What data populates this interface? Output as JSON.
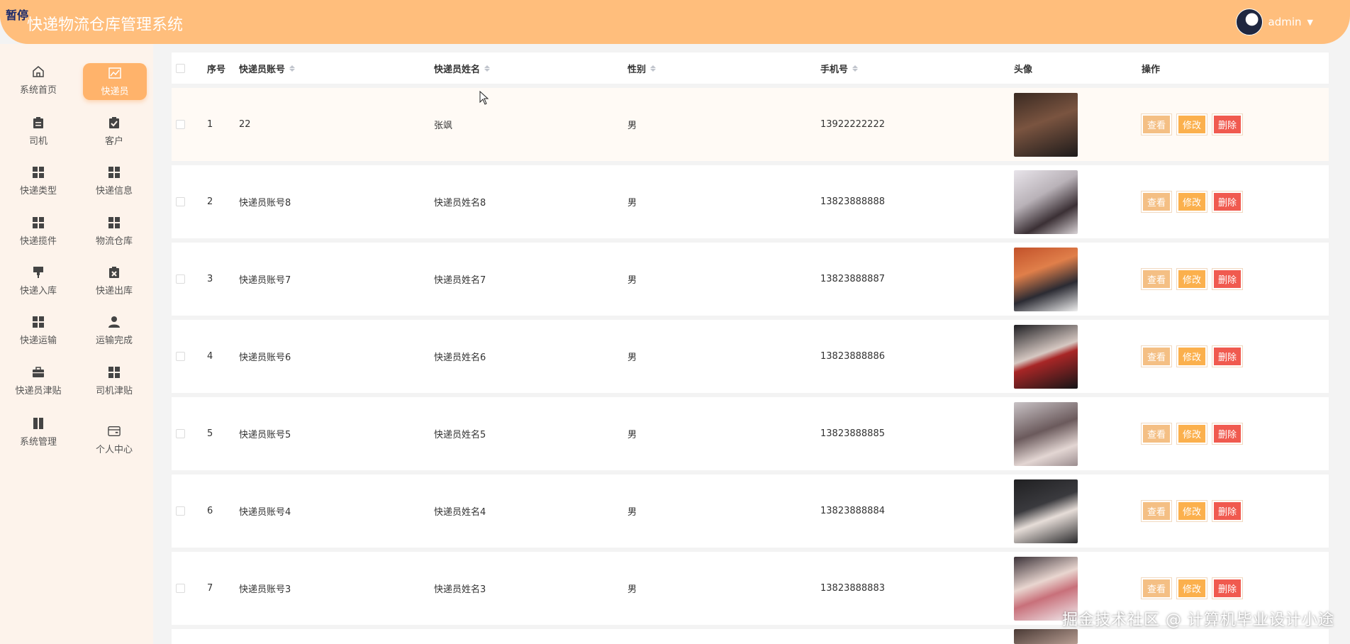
{
  "header": {
    "tag": "暂停",
    "title": "快递物流仓库管理系统",
    "username": "admin"
  },
  "sidebar": {
    "items": [
      {
        "label": "系统首页",
        "icon": "home-icon"
      },
      {
        "label": "快递员",
        "icon": "chart-icon",
        "active": true
      },
      {
        "label": "司机",
        "icon": "clipboard-icon"
      },
      {
        "label": "客户",
        "icon": "clipboard-check-icon"
      },
      {
        "label": "快递类型",
        "icon": "grid-icon"
      },
      {
        "label": "快递信息",
        "icon": "grid-icon"
      },
      {
        "label": "快递揽件",
        "icon": "grid-icon"
      },
      {
        "label": "物流仓库",
        "icon": "grid-icon"
      },
      {
        "label": "快递入库",
        "icon": "brush-icon"
      },
      {
        "label": "快递出库",
        "icon": "clipboard-x-icon"
      },
      {
        "label": "快递运输",
        "icon": "grid-icon"
      },
      {
        "label": "运输完成",
        "icon": "person-icon"
      },
      {
        "label": "快递员津贴",
        "icon": "briefcase-icon"
      },
      {
        "label": "司机津贴",
        "icon": "grid-icon"
      },
      {
        "label": "系统管理",
        "icon": "book-icon"
      },
      {
        "label": "个人中心",
        "icon": "card-icon"
      }
    ]
  },
  "table": {
    "headers": {
      "index": "序号",
      "account": "快递员账号",
      "name": "快递员姓名",
      "gender": "性别",
      "phone": "手机号",
      "avatar": "头像",
      "actions": "操作"
    },
    "actions": {
      "view": "查看",
      "edit": "修改",
      "delete": "删除"
    },
    "rows": [
      {
        "index": "1",
        "account": "22",
        "name": "张飒",
        "gender": "男",
        "phone": "13922222222"
      },
      {
        "index": "2",
        "account": "快递员账号8",
        "name": "快递员姓名8",
        "gender": "男",
        "phone": "13823888888"
      },
      {
        "index": "3",
        "account": "快递员账号7",
        "name": "快递员姓名7",
        "gender": "男",
        "phone": "13823888887"
      },
      {
        "index": "4",
        "account": "快递员账号6",
        "name": "快递员姓名6",
        "gender": "男",
        "phone": "13823888886"
      },
      {
        "index": "5",
        "account": "快递员账号5",
        "name": "快递员姓名5",
        "gender": "男",
        "phone": "13823888885"
      },
      {
        "index": "6",
        "account": "快递员账号4",
        "name": "快递员姓名4",
        "gender": "男",
        "phone": "13823888884"
      },
      {
        "index": "7",
        "account": "快递员账号3",
        "name": "快递员姓名3",
        "gender": "男",
        "phone": "13823888883"
      }
    ]
  },
  "watermark": "掘金技术社区 @ 计算机毕业设计小途",
  "colors": {
    "header": "#ffbe7c",
    "sidebar": "#fdf3eb",
    "active_nav": "#ffb36b",
    "view_button": "#f4bf84",
    "edit_button": "#fbb04d",
    "delete_button": "#f05a4f"
  }
}
